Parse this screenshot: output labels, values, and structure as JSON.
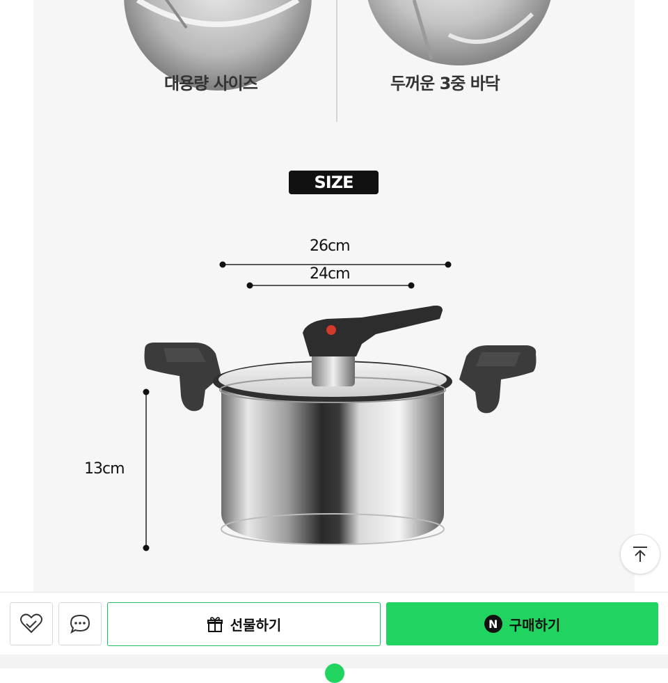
{
  "features": [
    {
      "label": "대용량 사이즈"
    },
    {
      "label": "두꺼운 3중 바닥"
    }
  ],
  "size_section": {
    "badge": "SIZE",
    "dimensions": {
      "outer_width": "26cm",
      "inner_width": "24cm",
      "height": "13cm"
    }
  },
  "bottom_bar": {
    "gift_label": "선물하기",
    "buy_label": "구매하기",
    "buy_badge": "N",
    "accent_color": "#21d35f"
  },
  "icons": {
    "like": "heart-check-icon",
    "talk": "chat-bubble-icon",
    "gift": "gift-icon",
    "scroll_top": "arrow-up-icon"
  }
}
